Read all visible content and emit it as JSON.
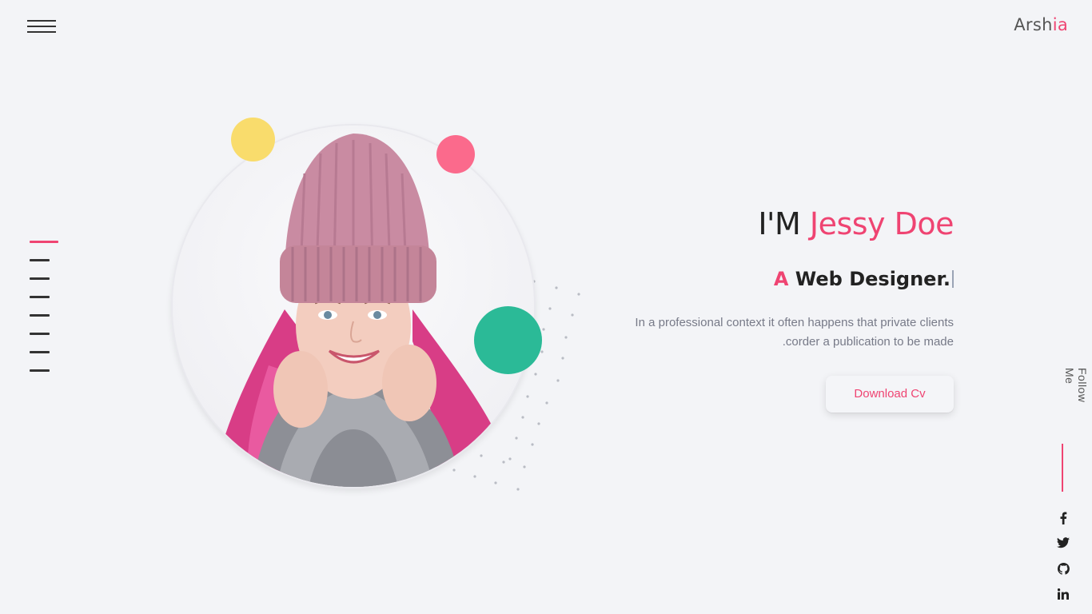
{
  "header": {
    "brand_prefix": "Arsh",
    "brand_accent": "ia"
  },
  "side_nav": {
    "count": 8,
    "active_index": 0
  },
  "intro": {
    "greeting": "I'M ",
    "name": "Jessy Doe",
    "role_prefix": "A",
    "role_text": " Web Designer.",
    "description_line1": "In a professional context it often happens that private clients",
    "description_line2": ".corder a publication to be made",
    "download_label": "Download Cv"
  },
  "follow": {
    "label": "Follow Me"
  },
  "socials": [
    {
      "name": "facebook-icon"
    },
    {
      "name": "twitter-icon"
    },
    {
      "name": "github-icon"
    },
    {
      "name": "linkedin-icon"
    }
  ],
  "colors": {
    "accent": "#ef4472",
    "background": "#f3f4f7",
    "yellow": "#f9dc6c",
    "pink": "#fb6a8c",
    "green": "#2bba97"
  }
}
